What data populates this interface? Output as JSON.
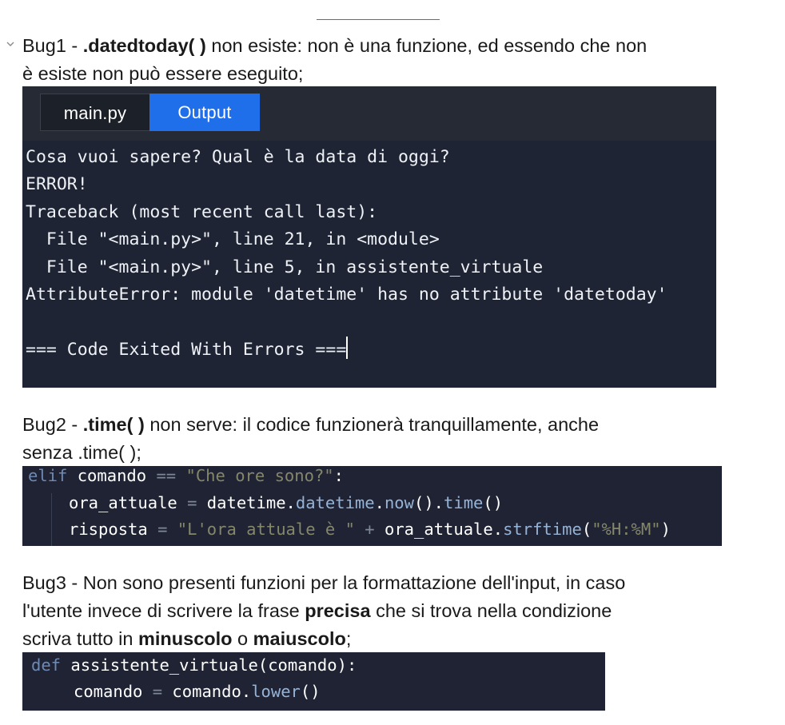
{
  "bug1": {
    "label": "Bug1 - ",
    "code": ".datedtoday( )",
    "text1": " non esiste: non è una funzione, ed essendo che non",
    "text2": "è esiste non può essere eseguito;"
  },
  "output_panel": {
    "tab_main": "main.py",
    "tab_output": "Output",
    "lines": [
      "Cosa vuoi sapere? Qual è la data di oggi?",
      "ERROR!",
      "Traceback (most recent call last):",
      "  File \"<main.py>\", line 21, in <module>",
      "  File \"<main.py>\", line 5, in assistente_virtuale",
      "AttributeError: module 'datetime' has no attribute 'datetoday'",
      "",
      "=== Code Exited With Errors ==="
    ]
  },
  "bug2": {
    "label": "Bug2 - ",
    "code": ".time( )",
    "text1": " non serve: il codice funzionerà tranquillamente, anche",
    "text2": "senza .time( );"
  },
  "code1": {
    "l1": [
      "elif",
      " comando ",
      "==",
      " ",
      "\"Che ore sono?\"",
      ":"
    ],
    "l2": [
      "ora_attuale ",
      "=",
      " datetime.",
      "datetime",
      ".",
      "now",
      "().",
      "time",
      "()"
    ],
    "l3": [
      "risposta ",
      "=",
      " ",
      "\"L'ora attuale è \"",
      " ",
      "+",
      " ora_attuale.",
      "strftime",
      "(",
      "\"%H:%M\"",
      ")"
    ]
  },
  "bug3": {
    "line1": "Bug3 - Non sono presenti funzioni per la formattazione dell'input, in caso",
    "line2_a": "l'utente invece di scrivere la frase ",
    "line2_b": "precisa",
    "line2_c": " che si trova nella condizione",
    "line3_a": "scriva tutto in ",
    "line3_b": "minuscolo",
    "line3_c": " o ",
    "line3_d": "maiuscolo",
    "line3_e": ";"
  },
  "code2": {
    "l1": [
      "def",
      " assistente_virtuale(comando):"
    ],
    "l2": [
      "comando ",
      "=",
      " comando.",
      "lower",
      "()"
    ]
  }
}
